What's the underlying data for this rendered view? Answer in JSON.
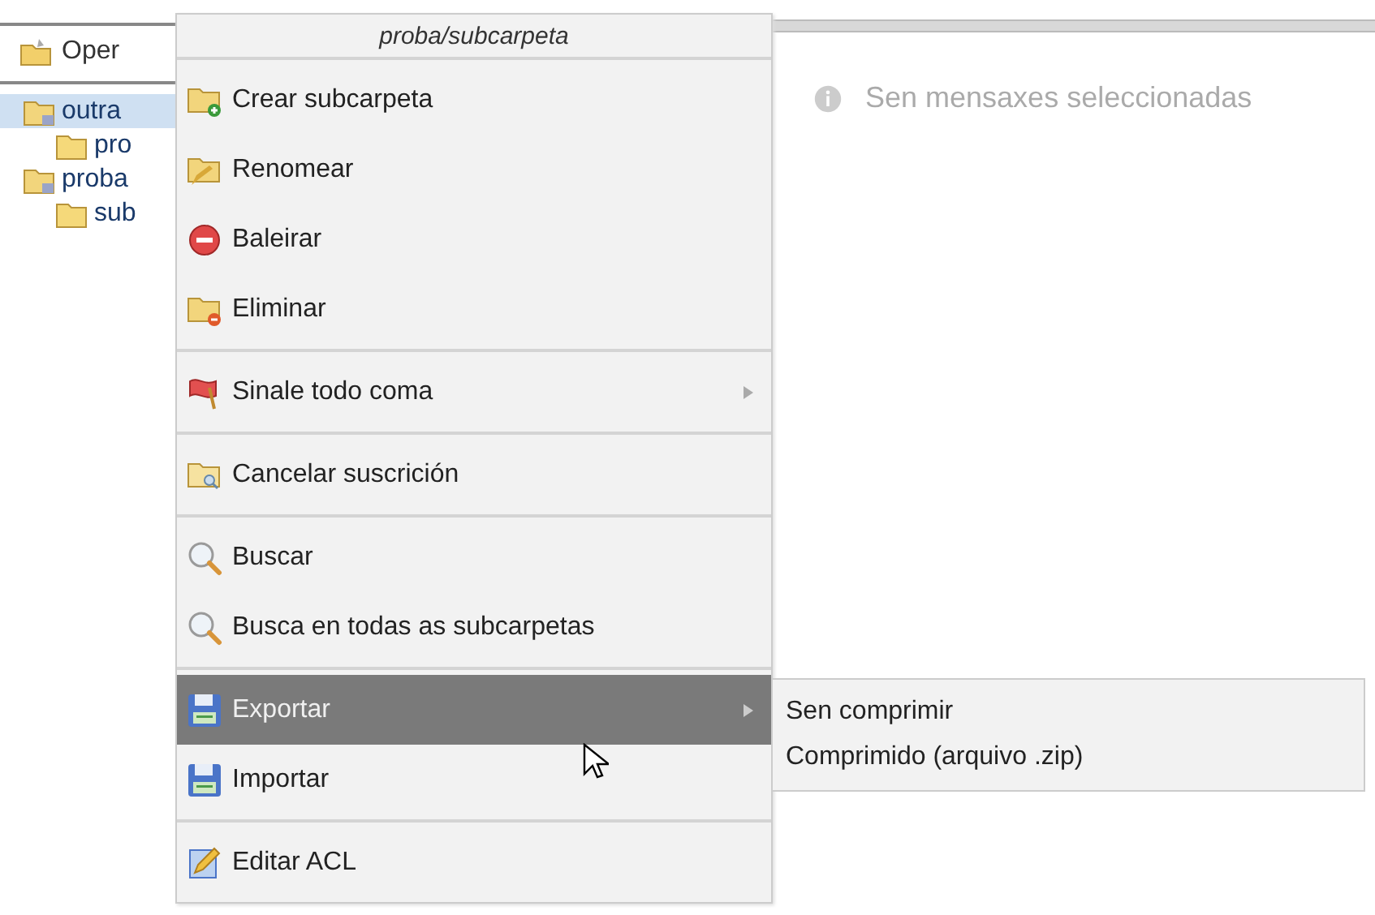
{
  "sidebar": {
    "header": "Oper",
    "folders": [
      {
        "label": "outra",
        "selected": true,
        "children": [
          {
            "label": "pro",
            "selected": false
          }
        ]
      },
      {
        "label": "proba",
        "selected": false,
        "children": [
          {
            "label": "sub",
            "selected": false
          }
        ]
      }
    ]
  },
  "main": {
    "message": "Sen mensaxes seleccionadas"
  },
  "context_menu": {
    "title": "proba/subcarpeta",
    "groups": [
      [
        {
          "label": "Crear subcarpeta",
          "kind": "add",
          "submenu": false,
          "selected": false
        },
        {
          "label": "Renomear",
          "kind": "rename",
          "submenu": false,
          "selected": false
        },
        {
          "label": "Baleirar",
          "kind": "empty",
          "submenu": false,
          "selected": false
        },
        {
          "label": "Eliminar",
          "kind": "remove",
          "submenu": false,
          "selected": false
        }
      ],
      [
        {
          "label": "Sinale todo coma",
          "kind": "mark",
          "submenu": true,
          "selected": false
        }
      ],
      [
        {
          "label": "Cancelar suscrición",
          "kind": "unsubscribe",
          "submenu": false,
          "selected": false
        }
      ],
      [
        {
          "label": "Buscar",
          "kind": "find",
          "submenu": false,
          "selected": false
        },
        {
          "label": "Busca en todas as subcarpetas",
          "kind": "find",
          "submenu": false,
          "selected": false
        }
      ],
      [
        {
          "label": "Exportar",
          "kind": "transfer",
          "submenu": true,
          "selected": true
        },
        {
          "label": "Importar",
          "kind": "transfer",
          "submenu": false,
          "selected": false
        }
      ],
      [
        {
          "label": "Editar ACL",
          "kind": "acl",
          "submenu": false,
          "selected": false
        }
      ]
    ]
  },
  "submenu": {
    "items": [
      {
        "label": "Sen comprimir"
      },
      {
        "label": "Comprimido (arquivo .zip)"
      }
    ]
  }
}
